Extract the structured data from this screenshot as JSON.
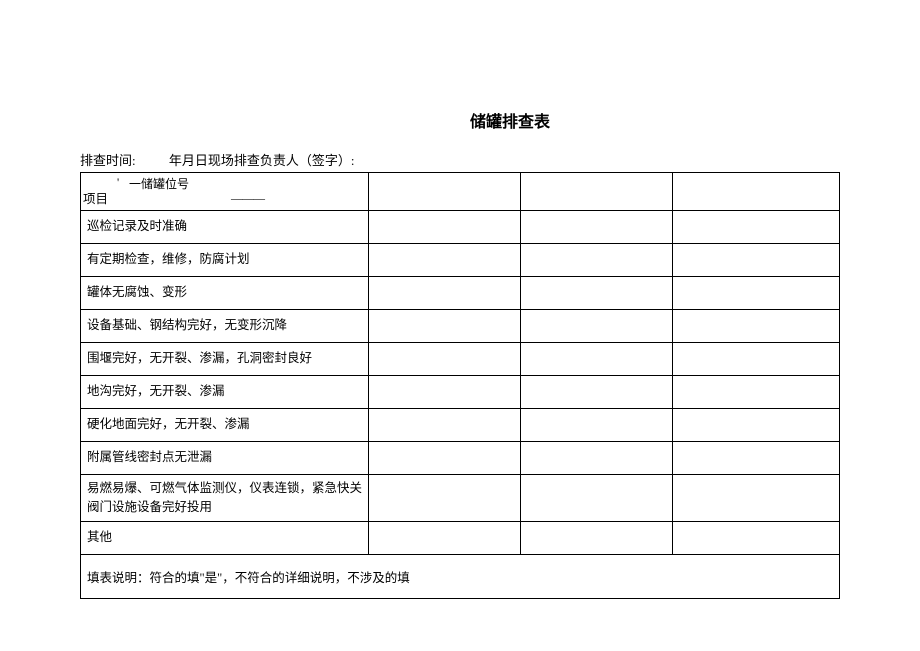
{
  "title": "储罐排查表",
  "meta": {
    "time_label": "排查时间:",
    "date_part": "年月日现场排查负责人（签字）:"
  },
  "header_cell": {
    "apostrophe": "'",
    "top_label": "一储罐位号",
    "bottom_label": "项目",
    "dash": "———"
  },
  "rows": [
    "巡检记录及时准确",
    "有定期检查，维修，防腐计划",
    "罐体无腐蚀、变形",
    "设备基础、钢结构完好，无变形沉降",
    "围堰完好，无开裂、渗漏，孔洞密封良好",
    "地沟完好，无开裂、渗漏",
    "硬化地面完好，无开裂、渗漏",
    "附属管线密封点无泄漏",
    "易燃易爆、可燃气体监测仪，仪表连锁，紧急快关阀门设施设备完好投用",
    "其他"
  ],
  "footer": "填表说明：符合的填\"是\"，不符合的详细说明，不涉及的填"
}
